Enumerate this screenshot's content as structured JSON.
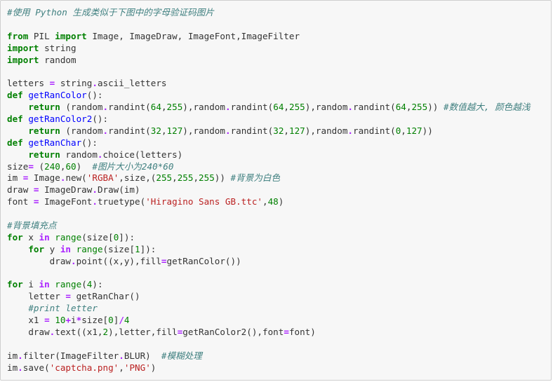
{
  "code_cell": {
    "lines": [
      [
        {
          "t": "cm",
          "v": "#使用 Python 生成类似于下图中的字母验证码图片"
        }
      ],
      [],
      [
        {
          "t": "kw",
          "v": "from"
        },
        {
          "t": "p",
          "v": " PIL "
        },
        {
          "t": "kw",
          "v": "import"
        },
        {
          "t": "p",
          "v": " Image, ImageDraw, ImageFont,ImageFilter"
        }
      ],
      [
        {
          "t": "kw",
          "v": "import"
        },
        {
          "t": "p",
          "v": " string"
        }
      ],
      [
        {
          "t": "kw",
          "v": "import"
        },
        {
          "t": "p",
          "v": " random"
        }
      ],
      [],
      [
        {
          "t": "p",
          "v": "letters "
        },
        {
          "t": "op",
          "v": "="
        },
        {
          "t": "p",
          "v": " string"
        },
        {
          "t": "op",
          "v": "."
        },
        {
          "t": "p",
          "v": "ascii_letters"
        }
      ],
      [
        {
          "t": "kw",
          "v": "def"
        },
        {
          "t": "p",
          "v": " "
        },
        {
          "t": "fn",
          "v": "getRanColor"
        },
        {
          "t": "p",
          "v": "():"
        }
      ],
      [
        {
          "t": "p",
          "v": "    "
        },
        {
          "t": "kw",
          "v": "return"
        },
        {
          "t": "p",
          "v": " (random"
        },
        {
          "t": "op",
          "v": "."
        },
        {
          "t": "p",
          "v": "randint("
        },
        {
          "t": "nu",
          "v": "64"
        },
        {
          "t": "p",
          "v": ","
        },
        {
          "t": "nu",
          "v": "255"
        },
        {
          "t": "p",
          "v": "),random"
        },
        {
          "t": "op",
          "v": "."
        },
        {
          "t": "p",
          "v": "randint("
        },
        {
          "t": "nu",
          "v": "64"
        },
        {
          "t": "p",
          "v": ","
        },
        {
          "t": "nu",
          "v": "255"
        },
        {
          "t": "p",
          "v": "),random"
        },
        {
          "t": "op",
          "v": "."
        },
        {
          "t": "p",
          "v": "randint("
        },
        {
          "t": "nu",
          "v": "64"
        },
        {
          "t": "p",
          "v": ","
        },
        {
          "t": "nu",
          "v": "255"
        },
        {
          "t": "p",
          "v": ")) "
        },
        {
          "t": "cm",
          "v": "#数值越大, 颜色越浅"
        }
      ],
      [
        {
          "t": "kw",
          "v": "def"
        },
        {
          "t": "p",
          "v": " "
        },
        {
          "t": "fn",
          "v": "getRanColor2"
        },
        {
          "t": "p",
          "v": "():"
        }
      ],
      [
        {
          "t": "p",
          "v": "    "
        },
        {
          "t": "kw",
          "v": "return"
        },
        {
          "t": "p",
          "v": " (random"
        },
        {
          "t": "op",
          "v": "."
        },
        {
          "t": "p",
          "v": "randint("
        },
        {
          "t": "nu",
          "v": "32"
        },
        {
          "t": "p",
          "v": ","
        },
        {
          "t": "nu",
          "v": "127"
        },
        {
          "t": "p",
          "v": "),random"
        },
        {
          "t": "op",
          "v": "."
        },
        {
          "t": "p",
          "v": "randint("
        },
        {
          "t": "nu",
          "v": "32"
        },
        {
          "t": "p",
          "v": ","
        },
        {
          "t": "nu",
          "v": "127"
        },
        {
          "t": "p",
          "v": "),random"
        },
        {
          "t": "op",
          "v": "."
        },
        {
          "t": "p",
          "v": "randint("
        },
        {
          "t": "nu",
          "v": "0"
        },
        {
          "t": "p",
          "v": ","
        },
        {
          "t": "nu",
          "v": "127"
        },
        {
          "t": "p",
          "v": "))"
        }
      ],
      [
        {
          "t": "kw",
          "v": "def"
        },
        {
          "t": "p",
          "v": " "
        },
        {
          "t": "fn",
          "v": "getRanChar"
        },
        {
          "t": "p",
          "v": "():"
        }
      ],
      [
        {
          "t": "p",
          "v": "    "
        },
        {
          "t": "kw",
          "v": "return"
        },
        {
          "t": "p",
          "v": " random"
        },
        {
          "t": "op",
          "v": "."
        },
        {
          "t": "p",
          "v": "choice(letters)"
        }
      ],
      [
        {
          "t": "p",
          "v": "size"
        },
        {
          "t": "op",
          "v": "="
        },
        {
          "t": "p",
          "v": " ("
        },
        {
          "t": "nu",
          "v": "240"
        },
        {
          "t": "p",
          "v": ","
        },
        {
          "t": "nu",
          "v": "60"
        },
        {
          "t": "p",
          "v": ")  "
        },
        {
          "t": "cm",
          "v": "#图片大小为240*60"
        }
      ],
      [
        {
          "t": "p",
          "v": "im "
        },
        {
          "t": "op",
          "v": "="
        },
        {
          "t": "p",
          "v": " Image"
        },
        {
          "t": "op",
          "v": "."
        },
        {
          "t": "p",
          "v": "new("
        },
        {
          "t": "st",
          "v": "'RGBA'"
        },
        {
          "t": "p",
          "v": ",size,("
        },
        {
          "t": "nu",
          "v": "255"
        },
        {
          "t": "p",
          "v": ","
        },
        {
          "t": "nu",
          "v": "255"
        },
        {
          "t": "p",
          "v": ","
        },
        {
          "t": "nu",
          "v": "255"
        },
        {
          "t": "p",
          "v": ")) "
        },
        {
          "t": "cm",
          "v": "#背景为白色"
        }
      ],
      [
        {
          "t": "p",
          "v": "draw "
        },
        {
          "t": "op",
          "v": "="
        },
        {
          "t": "p",
          "v": " ImageDraw"
        },
        {
          "t": "op",
          "v": "."
        },
        {
          "t": "p",
          "v": "Draw(im)"
        }
      ],
      [
        {
          "t": "p",
          "v": "font "
        },
        {
          "t": "op",
          "v": "="
        },
        {
          "t": "p",
          "v": " ImageFont"
        },
        {
          "t": "op",
          "v": "."
        },
        {
          "t": "p",
          "v": "truetype("
        },
        {
          "t": "st",
          "v": "'Hiragino Sans GB.ttc'"
        },
        {
          "t": "p",
          "v": ","
        },
        {
          "t": "nu",
          "v": "48"
        },
        {
          "t": "p",
          "v": ")"
        }
      ],
      [],
      [
        {
          "t": "cm",
          "v": "#背景填充点"
        }
      ],
      [
        {
          "t": "kw",
          "v": "for"
        },
        {
          "t": "p",
          "v": " x "
        },
        {
          "t": "op",
          "v": "in"
        },
        {
          "t": "p",
          "v": " "
        },
        {
          "t": "nb",
          "v": "range"
        },
        {
          "t": "p",
          "v": "(size["
        },
        {
          "t": "nu",
          "v": "0"
        },
        {
          "t": "p",
          "v": "]):"
        }
      ],
      [
        {
          "t": "p",
          "v": "    "
        },
        {
          "t": "kw",
          "v": "for"
        },
        {
          "t": "p",
          "v": " y "
        },
        {
          "t": "op",
          "v": "in"
        },
        {
          "t": "p",
          "v": " "
        },
        {
          "t": "nb",
          "v": "range"
        },
        {
          "t": "p",
          "v": "(size["
        },
        {
          "t": "nu",
          "v": "1"
        },
        {
          "t": "p",
          "v": "]):"
        }
      ],
      [
        {
          "t": "p",
          "v": "        draw"
        },
        {
          "t": "op",
          "v": "."
        },
        {
          "t": "p",
          "v": "point((x,y),fill"
        },
        {
          "t": "op",
          "v": "="
        },
        {
          "t": "p",
          "v": "getRanColor())"
        }
      ],
      [],
      [
        {
          "t": "kw",
          "v": "for"
        },
        {
          "t": "p",
          "v": " i "
        },
        {
          "t": "op",
          "v": "in"
        },
        {
          "t": "p",
          "v": " "
        },
        {
          "t": "nb",
          "v": "range"
        },
        {
          "t": "p",
          "v": "("
        },
        {
          "t": "nu",
          "v": "4"
        },
        {
          "t": "p",
          "v": "):"
        }
      ],
      [
        {
          "t": "p",
          "v": "    letter "
        },
        {
          "t": "op",
          "v": "="
        },
        {
          "t": "p",
          "v": " getRanChar()"
        }
      ],
      [
        {
          "t": "p",
          "v": "    "
        },
        {
          "t": "cm",
          "v": "#print letter"
        }
      ],
      [
        {
          "t": "p",
          "v": "    x1 "
        },
        {
          "t": "op",
          "v": "="
        },
        {
          "t": "p",
          "v": " "
        },
        {
          "t": "nu",
          "v": "10"
        },
        {
          "t": "op",
          "v": "+"
        },
        {
          "t": "p",
          "v": "i"
        },
        {
          "t": "op",
          "v": "*"
        },
        {
          "t": "p",
          "v": "size["
        },
        {
          "t": "nu",
          "v": "0"
        },
        {
          "t": "p",
          "v": "]"
        },
        {
          "t": "op",
          "v": "/"
        },
        {
          "t": "nu",
          "v": "4"
        }
      ],
      [
        {
          "t": "p",
          "v": "    draw"
        },
        {
          "t": "op",
          "v": "."
        },
        {
          "t": "p",
          "v": "text((x1,"
        },
        {
          "t": "nu",
          "v": "2"
        },
        {
          "t": "p",
          "v": "),letter,fill"
        },
        {
          "t": "op",
          "v": "="
        },
        {
          "t": "p",
          "v": "getRanColor2(),font"
        },
        {
          "t": "op",
          "v": "="
        },
        {
          "t": "p",
          "v": "font)"
        }
      ],
      [],
      [
        {
          "t": "p",
          "v": "im"
        },
        {
          "t": "op",
          "v": "."
        },
        {
          "t": "p",
          "v": "filter(ImageFilter"
        },
        {
          "t": "op",
          "v": "."
        },
        {
          "t": "p",
          "v": "BLUR)  "
        },
        {
          "t": "cm",
          "v": "#模糊处理"
        }
      ],
      [
        {
          "t": "p",
          "v": "im"
        },
        {
          "t": "op",
          "v": "."
        },
        {
          "t": "p",
          "v": "save("
        },
        {
          "t": "st",
          "v": "'captcha.png'"
        },
        {
          "t": "p",
          "v": ","
        },
        {
          "t": "st",
          "v": "'PNG'"
        },
        {
          "t": "p",
          "v": ")"
        }
      ]
    ]
  },
  "colors": {
    "cell_background": "#f7f7f7",
    "cell_border": "#cfcfcf",
    "keyword": "#008000",
    "comment": "#408080",
    "function_name": "#0000ff",
    "operator": "#aa22ff",
    "string": "#ba2121",
    "number": "#008000",
    "plain_text": "#333333"
  }
}
